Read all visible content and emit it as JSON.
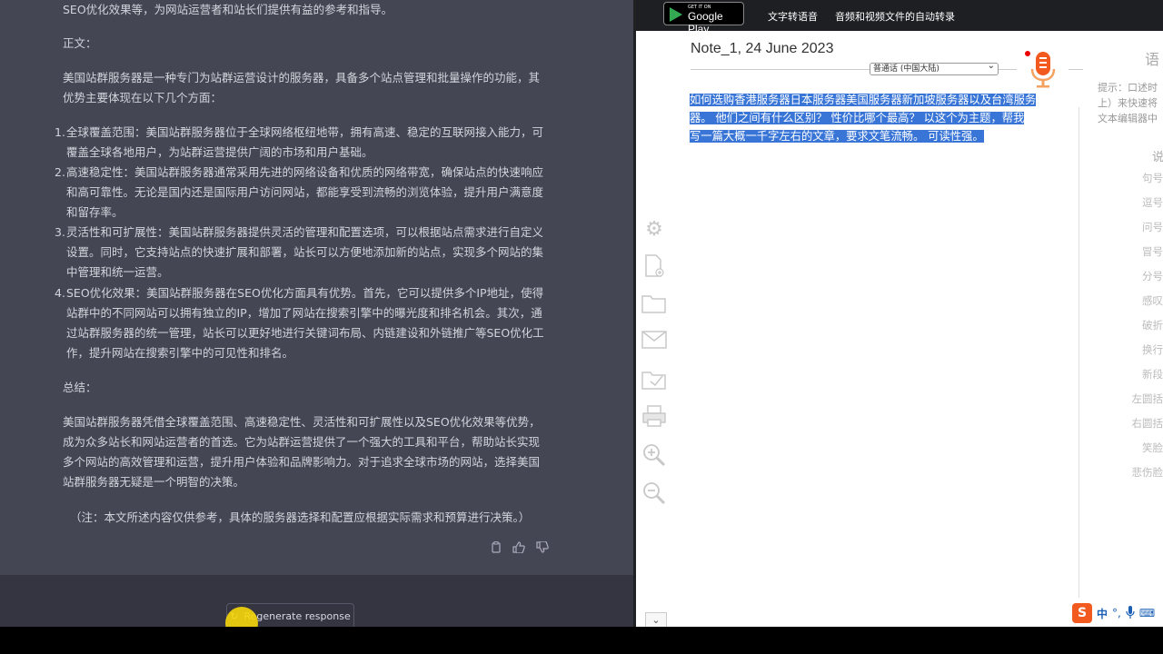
{
  "chat": {
    "intro_line": "SEO优化效果等，为网站运营者和站长们提供有益的参考和指导。",
    "body_label": "正文：",
    "para1_line1": "美国站群服务器是一种专门为站群运营设计的服务器，具备多个站点管理和批量操作的功能，其",
    "para1_line2": "优势主要体现在以下几个方面：",
    "items": [
      {
        "num": "1.",
        "lines": [
          "全球覆盖范围：美国站群服务器位于全球网络枢纽地带，拥有高速、稳定的互联网接入能力，可",
          "覆盖全球各地用户，为站群运营提供广阔的市场和用户基础。"
        ]
      },
      {
        "num": "2.",
        "lines": [
          "高速稳定性：美国站群服务器通常采用先进的网络设备和优质的网络带宽，确保站点的快速响应",
          "和高可靠性。无论是国内还是国际用户访问网站，都能享受到流畅的浏览体验，提升用户满意度",
          "和留存率。"
        ]
      },
      {
        "num": "3.",
        "lines": [
          "灵活性和可扩展性：美国站群服务器提供灵活的管理和配置选项，可以根据站点需求进行自定义",
          "设置。同时，它支持站点的快速扩展和部署，站长可以方便地添加新的站点，实现多个网站的集",
          "中管理和统一运营。"
        ]
      },
      {
        "num": "4.",
        "lines": [
          "SEO优化效果：美国站群服务器在SEO优化方面具有优势。首先，它可以提供多个IP地址，使得",
          "站群中的不同网站可以拥有独立的IP，增加了网站在搜索引擎中的曝光度和排名机会。其次，通",
          "过站群服务器的统一管理，站长可以更好地进行关键词布局、内链建设和外链推广等SEO优化工",
          "作，提升网站在搜索引擎中的可见性和排名。"
        ]
      }
    ],
    "summary_label": "总结：",
    "summary_lines": [
      "美国站群服务器凭借全球覆盖范围、高速稳定性、灵活性和可扩展性以及SEO优化效果等优势，",
      "成为众多站长和网站运营者的首选。它为站群运营提供了一个强大的工具和平台，帮助站长实现",
      "多个网站的高效管理和运营，提升用户体验和品牌影响力。对于追求全球市场的网站，选择美国",
      "站群服务器无疑是一个明智的决策。"
    ],
    "note": "（注：本文所述内容仅供参考，具体的服务器选择和配置应根据实际需求和预算进行决策。）",
    "regen_label": "Regenerate response"
  },
  "app": {
    "gplay_small": "GET IT ON",
    "gplay_big": "Google Play",
    "nav1": "文字转语音",
    "nav2": "音频和视频文件的自动转录",
    "note_title": "Note_1, 24 June 2023",
    "language": "普通话 (中国大陆)",
    "selected_lines": [
      "如何选购香港服务器日本服务器美国服务器新加坡服务器以及台湾服务",
      "器。 他们之间有什么区别？ 性价比哪个最高？ 以这个为主题，帮我",
      "写一篇大概一千字左右的文章，要求文笔流畅。 可读性强。"
    ],
    "side_title": "语",
    "side_hint": [
      "提示：口述时",
      "上）来快速将",
      "文本编辑器中"
    ],
    "side_cmd_head": "说",
    "side_cmds": [
      "句号",
      "逗号",
      "问号",
      "冒号",
      "分号",
      "感叹",
      "破折",
      "换行",
      "新段",
      "左圆括",
      "右圆括",
      "笑脸",
      "悲伤脸"
    ],
    "ime_text": "中"
  },
  "colors": {
    "chat_bg": "#444654",
    "selection": "#3875d7",
    "accent_orange": "#f25a20"
  }
}
